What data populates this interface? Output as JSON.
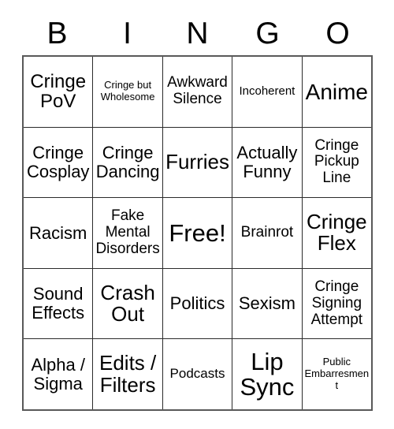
{
  "card": {
    "header_letters": [
      "B",
      "I",
      "N",
      "G",
      "O"
    ],
    "free_space_label": "Free!",
    "colors": {
      "text": "#000000",
      "grid_line": "#2b2b2b",
      "outer_border": "#595959",
      "background": "#ffffff"
    },
    "rows": [
      [
        {
          "label": "Cringe\nPoV",
          "size": "fs-xl"
        },
        {
          "label": "Cringe but\nWholesome",
          "size": "fs-xs"
        },
        {
          "label": "Awkward\nSilence",
          "size": "fs-md"
        },
        {
          "label": "Incoherent",
          "size": "fs-sm"
        },
        {
          "label": "Anime",
          "size": "fs-3xl"
        }
      ],
      [
        {
          "label": "Cringe\nCosplay",
          "size": "fs-lg"
        },
        {
          "label": "Cringe\nDancing",
          "size": "fs-lg"
        },
        {
          "label": "Furries",
          "size": "fs-2xl"
        },
        {
          "label": "Actually\nFunny",
          "size": "fs-lg"
        },
        {
          "label": "Cringe\nPickup\nLine",
          "size": "fs-md"
        }
      ],
      [
        {
          "label": "Racism",
          "size": "fs-lg"
        },
        {
          "label": "Fake\nMental\nDisorders",
          "size": "fs-md"
        },
        {
          "label": "Free!",
          "size": "fs-4xl"
        },
        {
          "label": "Brainrot",
          "size": "fs-md"
        },
        {
          "label": "Cringe\nFlex",
          "size": "fs-2xl"
        }
      ],
      [
        {
          "label": "Sound\nEffects",
          "size": "fs-lg"
        },
        {
          "label": "Crash\nOut",
          "size": "fs-2xl"
        },
        {
          "label": "Politics",
          "size": "fs-lg"
        },
        {
          "label": "Sexism",
          "size": "fs-lg"
        },
        {
          "label": "Cringe\nSigning\nAttempt",
          "size": "fs-md"
        }
      ],
      [
        {
          "label": "Alpha /\nSigma",
          "size": "fs-lg"
        },
        {
          "label": "Edits /\nFilters",
          "size": "fs-2xl"
        },
        {
          "label": "Podcasts",
          "size": "fs-smd"
        },
        {
          "label": "Lip\nSync",
          "size": "fs-4xl"
        },
        {
          "label": "Public\nEmbarresment",
          "size": "fs-xs"
        }
      ]
    ]
  }
}
